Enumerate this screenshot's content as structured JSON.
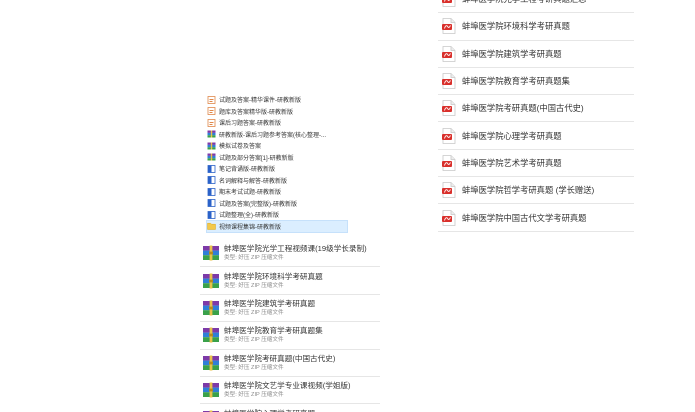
{
  "pdf_list": {
    "items": [
      {
        "label": "蚌埠医学院光学工程考研真题汇总"
      },
      {
        "label": "蚌埠医学院环境科学考研真题"
      },
      {
        "label": "蚌埠医学院建筑学考研真题"
      },
      {
        "label": "蚌埠医学院教育学考研真题集"
      },
      {
        "label": "蚌埠医学院考研真题(中国古代史)"
      },
      {
        "label": "蚌埠医学院心理学考研真题"
      },
      {
        "label": "蚌埠医学院艺术学考研真题"
      },
      {
        "label": "蚌埠医学院哲学考研真题 (学长赠送)"
      },
      {
        "label": "蚌埠医学院中国古代文学考研真题"
      }
    ]
  },
  "file_list": {
    "items": [
      {
        "label": "试题及答案-精华课件-研教新版",
        "icon": "doc-icon",
        "selected": false
      },
      {
        "label": "题库及答案精华版-研教新版",
        "icon": "doc-icon",
        "selected": false
      },
      {
        "label": "课后习题答案-研教新版",
        "icon": "doc-icon",
        "selected": false
      },
      {
        "label": "研教新版-课后习题参考答案(核心整理-...",
        "icon": "archive-icon",
        "selected": false
      },
      {
        "label": "模拟试卷及答案",
        "icon": "archive-icon",
        "selected": false
      },
      {
        "label": "试题及部分答案[1]-研教新版",
        "icon": "archive-icon",
        "selected": false
      },
      {
        "label": "笔记背诵版-研教新版",
        "icon": "word-icon",
        "selected": false
      },
      {
        "label": "名词解释与解答-研教新版",
        "icon": "word-icon",
        "selected": false
      },
      {
        "label": "期末考试试题-研教新版",
        "icon": "word-icon",
        "selected": false
      },
      {
        "label": "试题及答案(完整版)-研教新版",
        "icon": "word-icon",
        "selected": false
      },
      {
        "label": "试题整理(全)-研教新版",
        "icon": "word-icon",
        "selected": false
      },
      {
        "label": "视频课程集锦-研教新版",
        "icon": "folder-icon",
        "selected": true
      }
    ]
  },
  "archive_list": {
    "subtitle": "类型: 好压 ZIP 压缩文件",
    "items": [
      {
        "title": "蚌埠医学院光学工程视频课(19级学长录制)"
      },
      {
        "title": "蚌埠医学院环境科学考研真题"
      },
      {
        "title": "蚌埠医学院建筑学考研真题"
      },
      {
        "title": "蚌埠医学院教育学考研真题集"
      },
      {
        "title": "蚌埠医学院考研真题(中国古代史)"
      },
      {
        "title": "蚌埠医学院文艺学专业课视频(学姐版)"
      },
      {
        "title": "蚌埠医学院心理学考研真题"
      }
    ]
  },
  "colors": {
    "pdf_red": "#d9302c",
    "selection": "#dbeeff"
  }
}
